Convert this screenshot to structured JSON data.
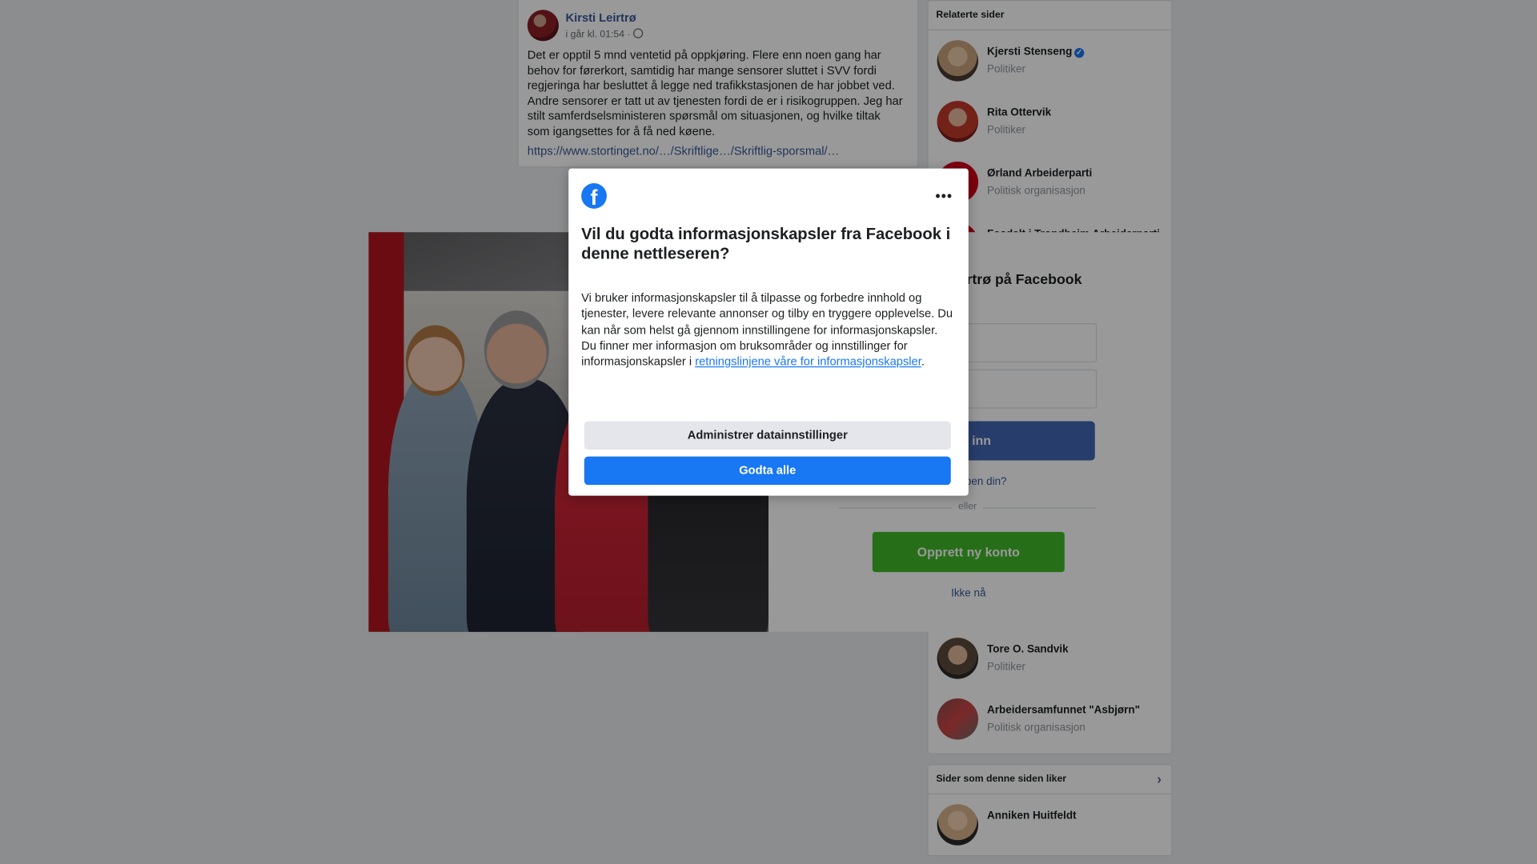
{
  "post": {
    "author": "Kirsti Leirtrø",
    "timestamp": "i går kl. 01:54 ·",
    "text": "Det er opptil 5 mnd ventetid på oppkjøring. Flere enn noen gang har behov for førerkort, samtidig har mange sensorer sluttet i SVV fordi regjeringa har besluttet å legge ned trafikkstasjonen de har jobbet ved. Andre sensorer er tatt ut av tjenesten fordi de er i risikogruppen. Jeg har stilt samferdselsministeren spørsmål om situasjonen, og hvilke tiltak som igangsettes for å få ned køene.",
    "link": "https://www.stortinget.no/…/Skriftlige…/Skriftlig-sporsmal/…"
  },
  "related": {
    "header": "Relaterte sider",
    "items": [
      {
        "name": "Kjersti Stenseng",
        "category": "Politiker",
        "verified": true,
        "color": "#c9a27c"
      },
      {
        "name": "Rita Ottervik",
        "category": "Politiker",
        "verified": false,
        "color": "#c0392b"
      },
      {
        "name": "Ørland Arbeiderparti",
        "category": "Politisk organisasjon",
        "verified": false,
        "color": "#d0021b"
      },
      {
        "name": "Fosdalt i Trondheim Arbeiderparti",
        "category": "",
        "verified": false,
        "color": "#d0021b"
      }
    ],
    "items_lower": [
      {
        "name": "Tore O. Sandvik",
        "category": "Politiker",
        "color": "#6b5a4a"
      },
      {
        "name": "Arbeidersamfunnet \"Asbjørn\"",
        "category": "Politisk organisasjon",
        "color": "#8a4d4d"
      }
    ]
  },
  "liked": {
    "header": "Sider som denne siden liker",
    "items": [
      {
        "name": "Anniken Huitfeldt",
        "color": "#d9b38c"
      }
    ]
  },
  "login": {
    "title": "eirtrø på Facebook",
    "login_button": "g inn",
    "forgot": "kontoen din?",
    "or": "eller",
    "create_button": "Opprett ny konto",
    "not_now": "Ikke nå"
  },
  "cookie_modal": {
    "logo": "f",
    "more": "•••",
    "title": "Vil du godta informasjonskapsler fra Facebook i denne nettleseren?",
    "body": "Vi bruker informasjonskapsler til å tilpasse og forbedre innhold og tjenester, levere relevante annonser og tilby en tryggere opplevelse. Du kan når som helst gå gjennom innstillingene for informasjonskapsler. Du finner mer informasjon om bruksområder og innstillinger for informasjonskapsler i ",
    "link_text": "retningslinjene våre for informasjonskapsler",
    "body_end": ".",
    "manage_button": "Administrer datainnstillinger",
    "accept_button": "Godta alle"
  },
  "colors": {
    "facebook_blue": "#1877f2",
    "login_blue": "#4267b2",
    "create_green": "#42b72a"
  }
}
